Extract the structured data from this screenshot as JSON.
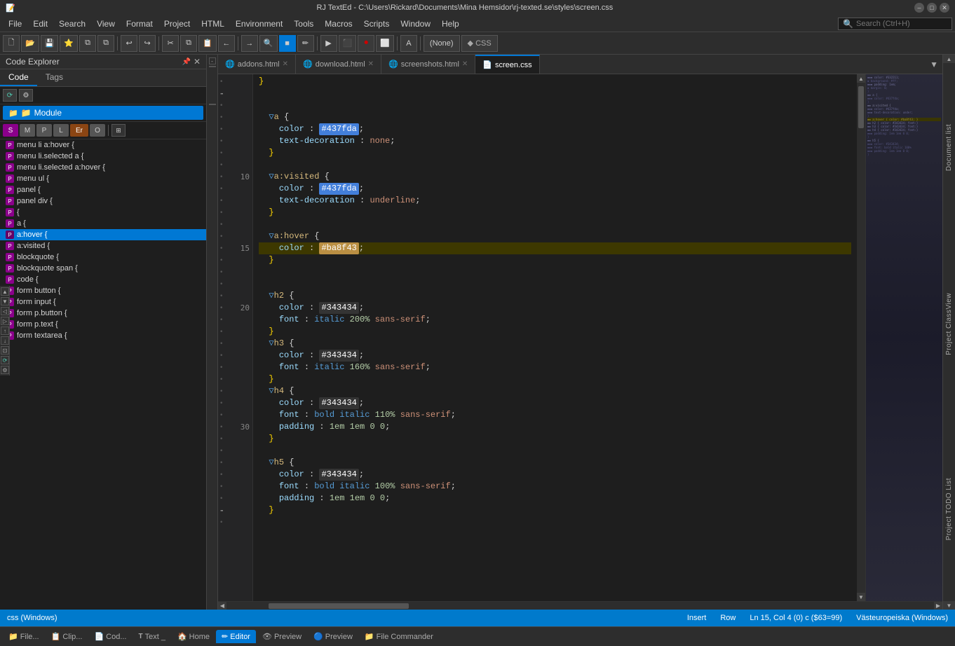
{
  "titlebar": {
    "title": "RJ TextEd - C:\\Users\\Rickard\\Documents\\Mina Hemsidor\\rj-texted.se\\styles\\screen.css",
    "min_label": "–",
    "max_label": "□",
    "close_label": "✕"
  },
  "menubar": {
    "items": [
      "File",
      "Edit",
      "Search",
      "View",
      "Format",
      "Project",
      "HTML",
      "Environment",
      "Tools",
      "Macros",
      "Scripts",
      "Window",
      "Help"
    ],
    "search_placeholder": "Search (Ctrl+H)"
  },
  "toolbar": {
    "buttons": [
      {
        "label": "🗋",
        "title": "New"
      },
      {
        "label": "📂",
        "title": "Open"
      },
      {
        "label": "💾",
        "title": "Save"
      },
      {
        "label": "⭐",
        "title": "Bookmark"
      },
      {
        "label": "⧉",
        "title": "Clone"
      },
      {
        "label": "⧉",
        "title": "Clone2"
      },
      {
        "label": "↩",
        "title": "Undo"
      },
      {
        "label": "↪",
        "title": "Redo"
      },
      {
        "label": "✂",
        "title": "Cut"
      },
      {
        "label": "⧉",
        "title": "Copy"
      },
      {
        "label": "📋",
        "title": "Paste"
      },
      {
        "label": "←",
        "title": "Back"
      },
      {
        "label": "→",
        "title": "Find"
      },
      {
        "label": "🔍",
        "title": "Search"
      },
      {
        "label": "■",
        "title": "Replace"
      },
      {
        "label": "▶",
        "title": "Run"
      },
      {
        "label": "⬛",
        "title": "Active"
      },
      {
        "label": "🔵",
        "title": "Record"
      },
      {
        "label": "⬜",
        "title": "Stop"
      },
      {
        "label": "A",
        "title": "Font"
      },
      {
        "label": "(None)",
        "title": "None"
      },
      {
        "label": "◆ CSS",
        "title": "CSS"
      }
    ]
  },
  "code_explorer": {
    "title": "Code Explorer",
    "tabs": [
      "Code",
      "Tags"
    ],
    "active_tab": "Code",
    "module_label": "Module",
    "snippet_buttons": [
      "S",
      "M",
      "P",
      "L",
      "Er",
      "O"
    ],
    "items": [
      {
        "label": "menu li a:hover {",
        "type": "P"
      },
      {
        "label": "menu li.selected a {",
        "type": "P"
      },
      {
        "label": "menu li.selected a:hover {",
        "type": "P"
      },
      {
        "label": "menu ul {",
        "type": "P"
      },
      {
        "label": "panel {",
        "type": "P"
      },
      {
        "label": "panel div {",
        "type": "P"
      },
      {
        "label": "{ ",
        "type": "P"
      },
      {
        "label": "a {",
        "type": "P"
      },
      {
        "label": "a:hover {",
        "type": "P",
        "selected": true
      },
      {
        "label": "a:visited {",
        "type": "P"
      },
      {
        "label": "blockquote {",
        "type": "P"
      },
      {
        "label": "blockquote span {",
        "type": "P"
      },
      {
        "label": "code {",
        "type": "P"
      },
      {
        "label": "form button {",
        "type": "P"
      },
      {
        "label": "form input {",
        "type": "P"
      },
      {
        "label": "form p.button {",
        "type": "P"
      },
      {
        "label": "form p.text {",
        "type": "P"
      },
      {
        "label": "form textarea {",
        "type": "P"
      }
    ]
  },
  "tabs": [
    {
      "label": "addons.html",
      "icon": "🌐",
      "active": false,
      "modified": false
    },
    {
      "label": "download.html",
      "icon": "🌐",
      "active": false,
      "modified": false
    },
    {
      "label": "screenshots.html",
      "icon": "🌐",
      "active": false,
      "modified": false
    },
    {
      "label": "screen.css",
      "icon": "📄",
      "active": true,
      "modified": false
    }
  ],
  "code": {
    "lines": [
      {
        "num": "",
        "marker": "dot",
        "content": "    }",
        "highlighted": false
      },
      {
        "num": "",
        "marker": "dash",
        "content": "  }",
        "highlighted": false
      },
      {
        "num": "",
        "marker": "dot",
        "content": "",
        "highlighted": false
      },
      {
        "num": "",
        "marker": "dot",
        "content": "  ▽a {",
        "highlighted": false
      },
      {
        "num": "",
        "marker": "dot",
        "content": "    color : #437fda;",
        "highlighted": false,
        "hasColorA": true
      },
      {
        "num": "",
        "marker": "dot",
        "content": "    text-decoration : none;",
        "highlighted": false
      },
      {
        "num": "",
        "marker": "dot",
        "content": "  }",
        "highlighted": false
      },
      {
        "num": "",
        "marker": "dot",
        "content": "",
        "highlighted": false
      },
      {
        "num": "10",
        "marker": "dot",
        "content": "  ▽a:visited {",
        "highlighted": false
      },
      {
        "num": "",
        "marker": "dot",
        "content": "    color : #437fda;",
        "highlighted": false,
        "hasColorA": true
      },
      {
        "num": "",
        "marker": "dot",
        "content": "    text-decoration : underline;",
        "highlighted": false
      },
      {
        "num": "",
        "marker": "dot",
        "content": "  }",
        "highlighted": false
      },
      {
        "num": "",
        "marker": "dot",
        "content": "",
        "highlighted": false
      },
      {
        "num": "",
        "marker": "dot",
        "content": "  ▽a:hover {",
        "highlighted": false
      },
      {
        "num": "15",
        "marker": "dot",
        "content": "    color : #ba8f43;",
        "highlighted": true,
        "hasColorB": true
      },
      {
        "num": "",
        "marker": "dot",
        "content": "  }",
        "highlighted": false
      },
      {
        "num": "",
        "marker": "dot",
        "content": "",
        "highlighted": false
      },
      {
        "num": "",
        "marker": "dot",
        "content": "",
        "highlighted": false
      },
      {
        "num": "",
        "marker": "dot",
        "content": "  ▽h2 {",
        "highlighted": false
      },
      {
        "num": "20",
        "marker": "dot",
        "content": "    color : #343434;",
        "highlighted": false,
        "hasColorC": true
      },
      {
        "num": "",
        "marker": "dot",
        "content": "    font : italic 200% sans-serif;",
        "highlighted": false
      },
      {
        "num": "",
        "marker": "dot",
        "content": "  }",
        "highlighted": false
      },
      {
        "num": "",
        "marker": "dot",
        "content": "  ▽h3 {",
        "highlighted": false
      },
      {
        "num": "",
        "marker": "dot",
        "content": "    color : #343434;",
        "highlighted": false,
        "hasColorC": true
      },
      {
        "num": "",
        "marker": "dot",
        "content": "    font : italic 160% sans-serif;",
        "highlighted": false
      },
      {
        "num": "",
        "marker": "dot",
        "content": "  }",
        "highlighted": false
      },
      {
        "num": "",
        "marker": "dot",
        "content": "  ▽h4 {",
        "highlighted": false
      },
      {
        "num": "",
        "marker": "dot",
        "content": "    color : #343434;",
        "highlighted": false,
        "hasColorC": true
      },
      {
        "num": "",
        "marker": "dot",
        "content": "    font : bold italic 110% sans-serif;",
        "highlighted": false
      },
      {
        "num": "30",
        "marker": "dot",
        "content": "    padding : 1em 1em 0 0;",
        "highlighted": false
      },
      {
        "num": "",
        "marker": "dot",
        "content": "  }",
        "highlighted": false
      },
      {
        "num": "",
        "marker": "dot",
        "content": "",
        "highlighted": false
      },
      {
        "num": "",
        "marker": "dot",
        "content": "  ▽h5 {",
        "highlighted": false
      },
      {
        "num": "",
        "marker": "dot",
        "content": "    color : #343434;",
        "highlighted": false,
        "hasColorC": true
      },
      {
        "num": "",
        "marker": "dot",
        "content": "    font : bold italic 100% sans-serif;",
        "highlighted": false
      },
      {
        "num": "",
        "marker": "dash",
        "content": "    padding : 1em 1em 0 0;",
        "highlighted": false
      },
      {
        "num": "",
        "marker": "dot",
        "content": "  }",
        "highlighted": false
      }
    ]
  },
  "right_panels": {
    "labels": [
      "Document list",
      "Project ClassView",
      "Project TODO List"
    ]
  },
  "statusbar": {
    "file_type": "css (Windows)",
    "mode": "Insert",
    "unit": "Row",
    "position": "Ln 15, Col 4 (0) c ($63=99)",
    "encoding": "Västeuropeiska (Windows)"
  },
  "bottom_tabs": [
    {
      "label": "File...",
      "icon": "📁",
      "active": false
    },
    {
      "label": "Clip...",
      "icon": "📋",
      "active": false
    },
    {
      "label": "Cod...",
      "icon": "📄",
      "active": false
    },
    {
      "label": "Text _",
      "icon": "T",
      "active": false
    },
    {
      "label": "Home",
      "icon": "🏠",
      "active": false
    },
    {
      "label": "Editor",
      "icon": "✏",
      "active": true
    },
    {
      "label": "Preview",
      "icon": "👁",
      "active": false
    },
    {
      "label": "Preview",
      "icon": "🔵",
      "active": false
    },
    {
      "label": "File Commander",
      "icon": "📁",
      "active": false
    }
  ]
}
